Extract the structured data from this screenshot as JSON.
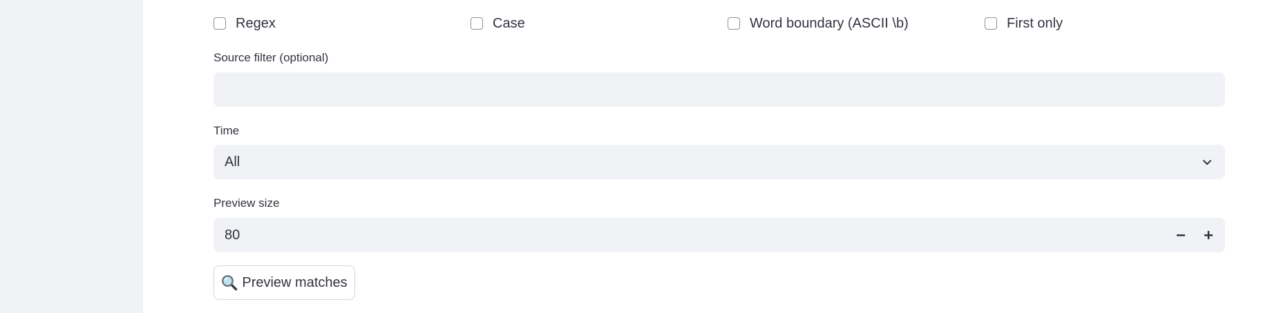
{
  "options": {
    "regex_label": "Regex",
    "case_label": "Case",
    "word_boundary_label": "Word boundary (ASCII \\b)",
    "first_only_label": "First only"
  },
  "source_filter": {
    "label": "Source filter (optional)",
    "value": ""
  },
  "time": {
    "label": "Time",
    "selected": "All"
  },
  "preview_size": {
    "label": "Preview size",
    "value": "80",
    "decrement_symbol": "−",
    "increment_symbol": "+"
  },
  "preview_button": {
    "label": "Preview matches",
    "icon": "magnifying-glass-icon"
  },
  "colors": {
    "sidebar_bg": "#f0f2f6",
    "input_bg": "#f0f2f6",
    "text": "#31333f",
    "checkbox_border": "#8e9098"
  }
}
